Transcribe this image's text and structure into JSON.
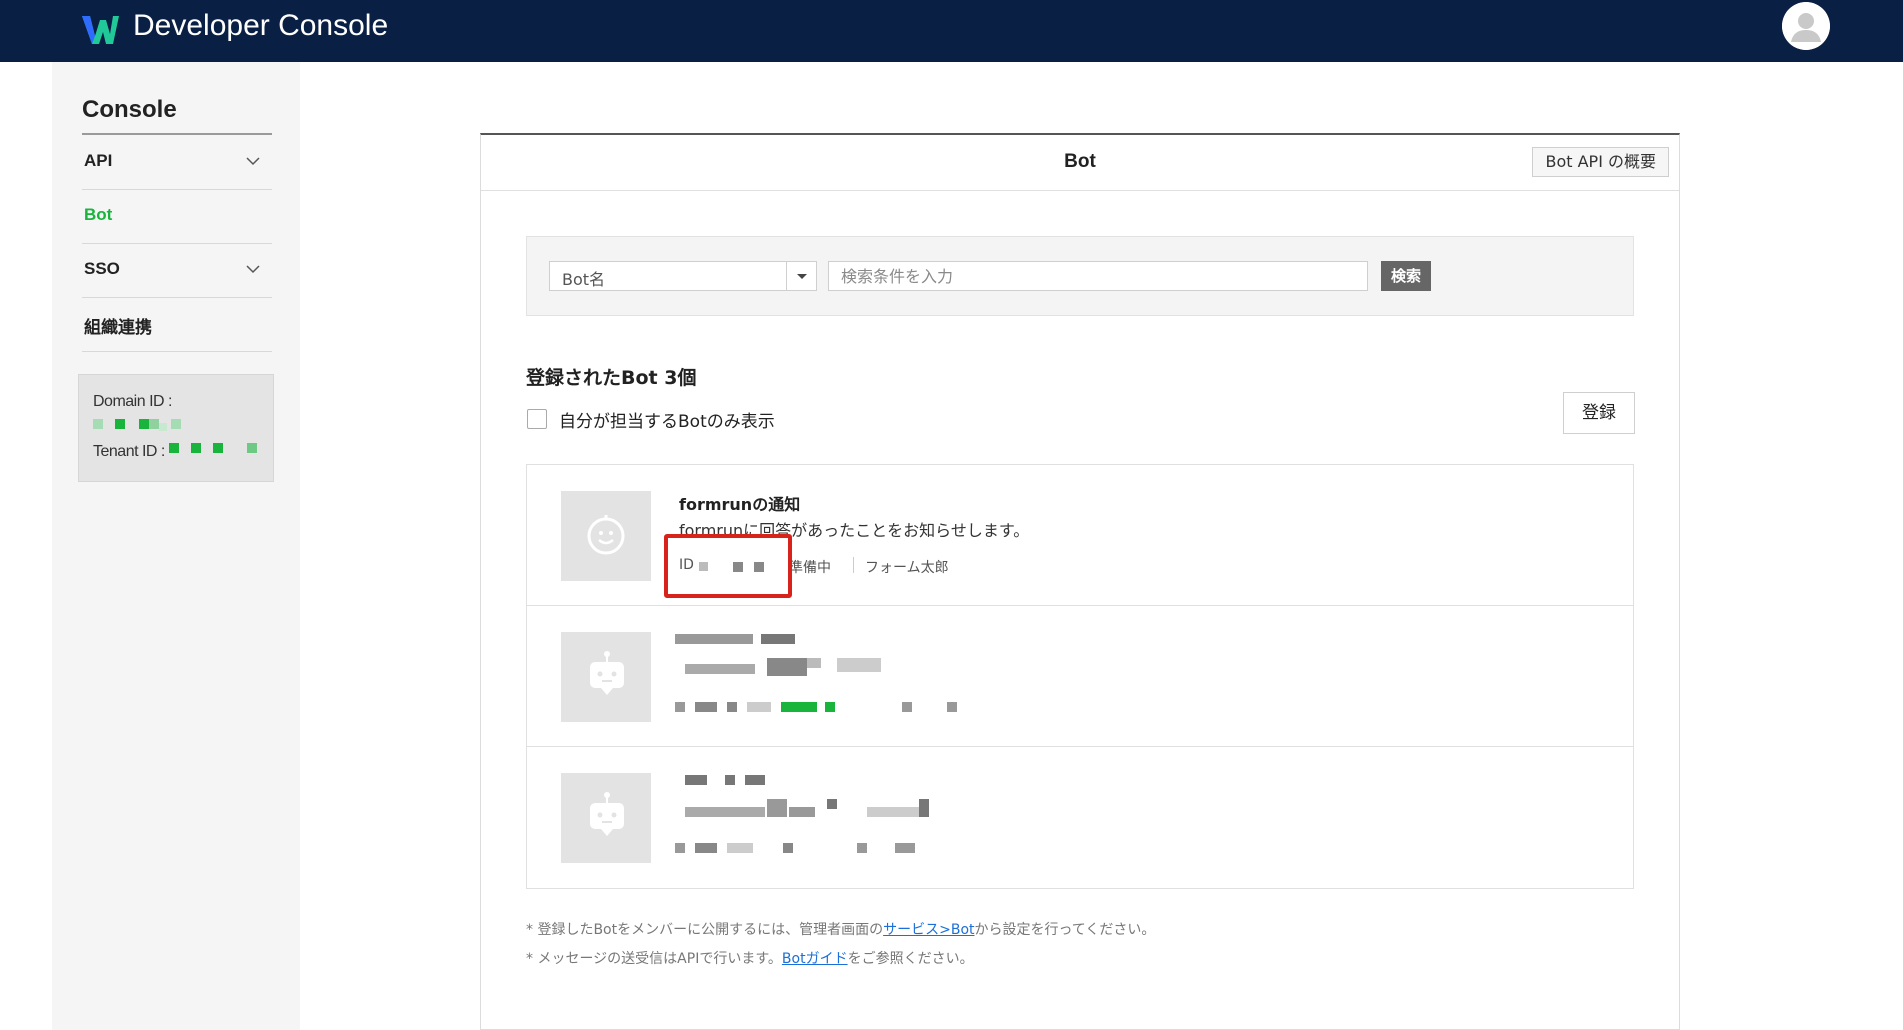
{
  "header": {
    "app_title": "Developer Console",
    "logo_icon": "works-logo-icon",
    "avatar_icon": "user-avatar-icon",
    "bg_color": "#0a1f44"
  },
  "sidebar": {
    "title": "Console",
    "items": [
      {
        "label": "API",
        "expandable": true,
        "active": false
      },
      {
        "label": "Bot",
        "expandable": false,
        "active": true
      },
      {
        "label": "SSO",
        "expandable": true,
        "active": false
      },
      {
        "label": "組織連携",
        "expandable": false,
        "active": false
      }
    ],
    "domain_id_label": "Domain ID :",
    "tenant_id_label": "Tenant ID :",
    "accent_color": "#18b43c"
  },
  "card": {
    "title": "Bot",
    "api_overview_label": "Bot API の概要"
  },
  "search": {
    "select_value": "Bot名",
    "input_placeholder": "検索条件を入力",
    "button_label": "検索"
  },
  "list_header": {
    "count_text": "登録されたBot 3個",
    "filter_label": "自分が担当するBotのみ表示",
    "filter_checked": false,
    "register_label": "登録"
  },
  "bots": [
    {
      "name": "formrunの通知",
      "description": "formrunに回答があったことをお知らせします。",
      "id_label": "ID",
      "status": "準備中",
      "owner": "フォーム太郎",
      "icon": "bot-smile-icon"
    },
    {
      "icon": "bot-icon",
      "redacted": true
    },
    {
      "icon": "bot-icon",
      "redacted": true
    }
  ],
  "notes": [
    {
      "prefix": "* 登録したBotをメンバーに公開するには、管理者画面の",
      "link": "サービス>Bot",
      "suffix": "から設定を行ってください。"
    },
    {
      "prefix": "* メッセージの送受信はAPIで行います。",
      "link": "Botガイド",
      "suffix": "をご参照ください。"
    }
  ]
}
